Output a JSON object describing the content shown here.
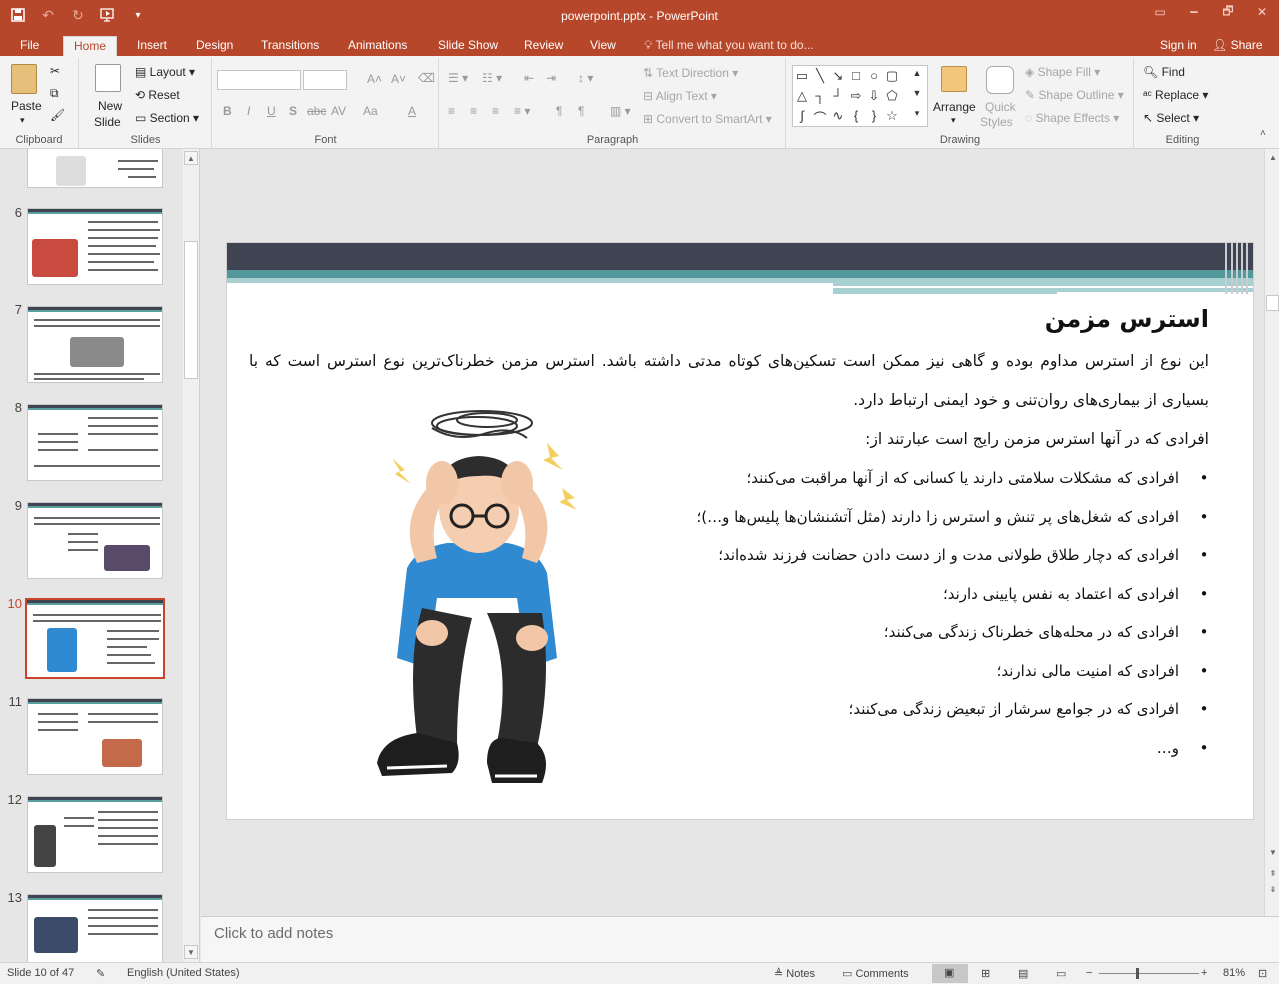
{
  "window": {
    "title": "powerpoint.pptx - PowerPoint",
    "controls": [
      "🗕",
      "🗗",
      "✕",
      "▭"
    ]
  },
  "tabs": [
    "File",
    "Home",
    "Insert",
    "Design",
    "Transitions",
    "Animations",
    "Slide Show",
    "Review",
    "View"
  ],
  "tell_me": "Tell me what you want to do...",
  "sign_in": "Sign in",
  "share": "Share",
  "ribbon": {
    "clipboard": {
      "label": "Clipboard",
      "paste": "Paste"
    },
    "slides": {
      "label": "Slides",
      "new_slide_1": "New",
      "new_slide_2": "Slide",
      "layout": "Layout",
      "reset": "Reset",
      "section": "Section"
    },
    "font": {
      "label": "Font",
      "bold": "B",
      "italic": "I",
      "underline": "U",
      "shadow": "S",
      "strike": "abc",
      "spacing": "AV",
      "case": "Aa"
    },
    "paragraph": {
      "label": "Paragraph",
      "text_direction": "Text Direction",
      "align_text": "Align Text",
      "smartart": "Convert to SmartArt"
    },
    "drawing": {
      "label": "Drawing",
      "arrange": "Arrange",
      "quick_styles_1": "Quick",
      "quick_styles_2": "Styles",
      "shape_fill": "Shape Fill",
      "shape_outline": "Shape Outline",
      "shape_effects": "Shape Effects"
    },
    "editing": {
      "label": "Editing",
      "find": "Find",
      "replace": "Replace",
      "select": "Select"
    }
  },
  "thumbnails": [
    {
      "num": "6"
    },
    {
      "num": "7"
    },
    {
      "num": "8"
    },
    {
      "num": "9"
    },
    {
      "num": "10"
    },
    {
      "num": "11"
    },
    {
      "num": "12"
    },
    {
      "num": "13"
    }
  ],
  "slide": {
    "title": "استرس مزمن",
    "paragraph": "این نوع از استرس مداوم بوده و گاهی نیز ممکن است تسکین‌های کوتاه مدتی داشته باشد. استرس مزمن خطرناک‌ترین نوع استرس است که با بسیاری از بیماری‌های روان‌تنی و خود ایمنی ارتباط دارد.",
    "intro": "افرادی که در آنها استرس مزمن رایج است عبارتند از:",
    "bullets": [
      "افرادی که مشکلات سلامتی دارند یا کسانی که از آنها مراقبت می‌کنند؛",
      "افرادی که شغل‌های پر تنش و استرس زا دارند (مثل آتشنشان‌ها پلیس‌ها و…)؛",
      "افرادی که دچار طلاق طولانی مدت و از دست دادن حضانت فرزند شده‌اند؛",
      "افرادی که اعتماد به نفس پایینی دارند؛",
      "افرادی که در محله‌های خطرناک زندگی می‌کنند؛",
      "افرادی که امنیت مالی ندارند؛",
      "افرادی که در جوامع سرشار از تبعیض زندگی می‌کنند؛",
      "و…"
    ]
  },
  "notes_placeholder": "Click to add notes",
  "status": {
    "slide_of": "Slide 10 of 47",
    "language": "English (United States)",
    "notes": "Notes",
    "comments": "Comments",
    "zoom": "81%"
  },
  "colors": {
    "accent": "#b7472a",
    "slide_dark_band": "#3f4352",
    "slide_teal_band": "#53999b"
  }
}
